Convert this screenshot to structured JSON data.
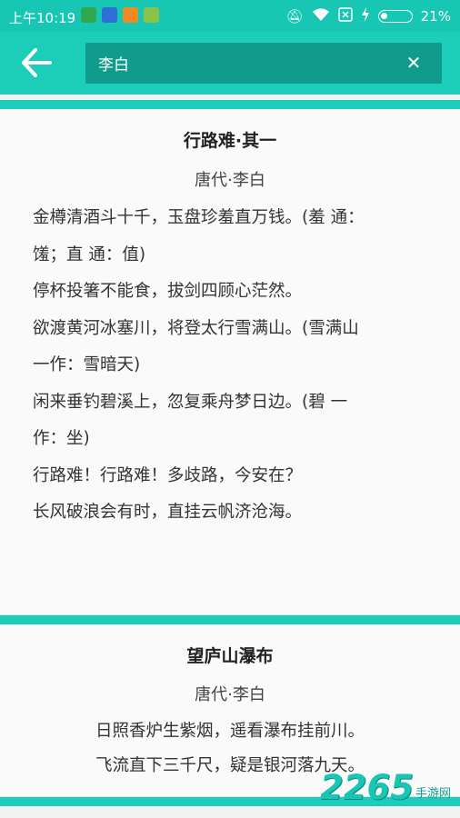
{
  "status_bar": {
    "time": "上午10:19",
    "battery_percent": "21%",
    "battery_level": 0.21,
    "left_icons": [
      "app-green-icon",
      "shield-blue-icon",
      "app-orange-icon",
      "app-lime-icon"
    ],
    "right_icons": [
      "mute-icon",
      "wifi-icon",
      "sim-icon",
      "charging-icon",
      "battery-icon"
    ]
  },
  "toolbar": {
    "back_icon": "arrow-left-icon",
    "search_value": "李白",
    "clear_icon": "close-icon"
  },
  "poems": [
    {
      "title": "行路难·其一",
      "author": "唐代·李白",
      "lines": [
        "金樽清酒斗十千，玉盘珍羞直万钱。(羞 通：",
        "馐；直 通：值)",
        "停杯投箸不能食，拔剑四顾心茫然。",
        "欲渡黄河冰塞川，将登太行雪满山。(雪满山",
        "一作：雪暗天)",
        "闲来垂钓碧溪上，忽复乘舟梦日边。(碧 一",
        "作：坐)",
        "行路难！行路难！多歧路，今安在？",
        "长风破浪会有时，直挂云帆济沧海。"
      ]
    },
    {
      "title": "望庐山瀑布",
      "author": "唐代·李白",
      "lines": [
        "日照香炉生紫烟，遥看瀑布挂前川。",
        "飞流直下三千尺，疑是银河落九天。"
      ]
    }
  ],
  "watermark": {
    "number": "2265",
    "text": "手游网",
    "logo": "2265-logo"
  },
  "colors": {
    "accent": "#1ccdb9",
    "search_bg": "#109c8d",
    "statusbar": "#17c6b3"
  }
}
